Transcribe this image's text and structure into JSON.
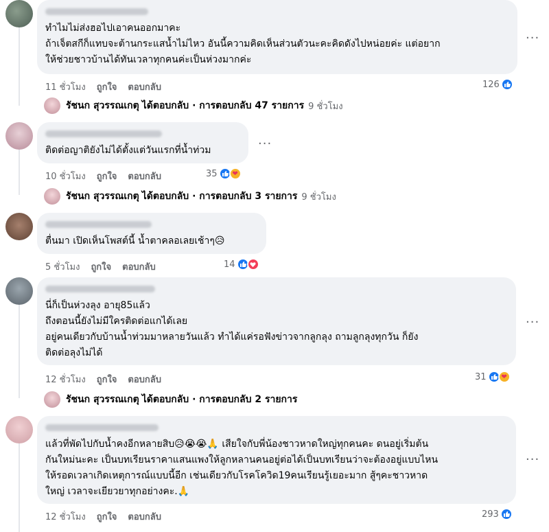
{
  "comments": [
    {
      "lines": [
        "ทำไมไม่ส่งฮอไปเอาคนออกมาคะ",
        "ถ้าเจ็ตสกีก็แทบจะต้านกระแสน้ำไม่ไหว อันนี้ความคิดเห็นส่วนตัวนะคะคิดดังไปหน่อยค่ะ แต่อยาก",
        "ให้ช่วยชาวบ้านได้ทันเวลาทุกคนค่ะเป็นห่วงมากค่ะ"
      ],
      "time": "11 ชั่วโมง",
      "like": "ถูกใจ",
      "reply": "ตอบกลับ",
      "reaction_count": "126",
      "reactions": [
        "like"
      ],
      "replies": {
        "name": "รัชนก สุวรรณเกตุ",
        "text": "ได้ตอบกลับ · การตอบกลับ 47 รายการ",
        "time": "9 ชั่วโมง"
      }
    },
    {
      "lines": [
        "ติดต่อญาติยังไม่ได้ตั้งแต่วันแรกที่น้ำท่วม"
      ],
      "time": "10 ชั่วโมง",
      "like": "ถูกใจ",
      "reply": "ตอบกลับ",
      "reaction_count": "35",
      "reactions": [
        "like",
        "care"
      ],
      "replies": {
        "name": "รัชนก สุวรรณเกตุ",
        "text": "ได้ตอบกลับ · การตอบกลับ 3 รายการ",
        "time": "9 ชั่วโมง"
      }
    },
    {
      "lines": [
        "ตื่นมา เปิดเห็นโพสต์นี้ น้ำตาคลอเลยเช้าๆ😥"
      ],
      "time": "5 ชั่วโมง",
      "like": "ถูกใจ",
      "reply": "ตอบกลับ",
      "reaction_count": "14",
      "reactions": [
        "like",
        "love"
      ]
    },
    {
      "lines": [
        "นี่ก็เป็นห่วงลุง อายุ85แล้ว",
        "ถึงตอนนี้ยังไม่มีใครติดต่อแกได้เลย",
        "อยู่คนเดียวกับบ้านน้ำท่วมมาหลายวันแล้ว ทำได้แค่รอฟังข่าวจากลูกลุง ถามลูกลุงทุกวัน ก็ยัง",
        "ติดต่อลุงไม่ได้"
      ],
      "time": "12 ชั่วโมง",
      "like": "ถูกใจ",
      "reply": "ตอบกลับ",
      "reaction_count": "31",
      "reactions": [
        "like",
        "care"
      ],
      "replies": {
        "name": "รัชนก สุวรรณเกตุ",
        "text": "ได้ตอบกลับ · การตอบกลับ 2 รายการ",
        "time": ""
      }
    },
    {
      "lines": [
        "แล้วที่พัดไปกับน้ำคงอีกหลายสิบ😥😭😭🙏 เสียใจกับพี่น้องชาวหาดใหญ่ทุกคนคะ ดนอยู่เริ่มต้น",
        "กันใหม่นะคะ เป็นบทเรียนราคาแสนแพงให้ลูกหลานคนอยู่ต่อได้เป็นบทเรียนว่าจะต้องอยู่แบบไหน",
        "ให้รอดเวลาเกิดเหตุการณ์แบบนี้อีก เช่นเดียวกับโรคโควิด19คนเรียนรู้เยอะมาก สู้ๆคะชาวหาด",
        "ใหญ่ เวลาจะเยียวยาทุกอย่างคะ.🙏"
      ],
      "time": "12 ชั่วโมง",
      "like": "ถูกใจ",
      "reply": "ตอบกลับ",
      "reaction_count": "293",
      "reactions": [
        "like"
      ]
    }
  ],
  "more_label": "···",
  "colors": {
    "like": "#1877f2",
    "love": "#f33e58",
    "care": "#f7b125",
    "bubble": "#f0f2f5",
    "meta": "#65676b"
  }
}
